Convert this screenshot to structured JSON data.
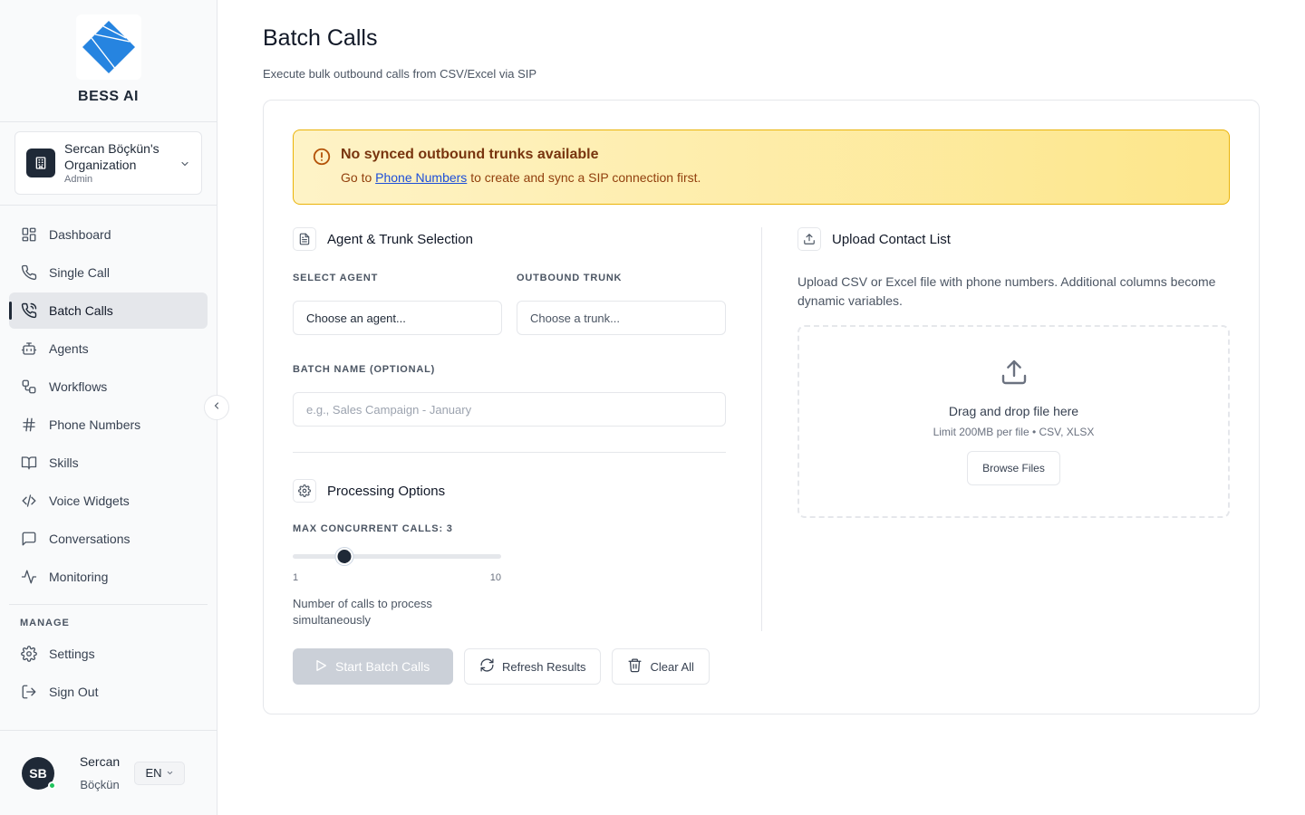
{
  "brand": {
    "name": "BESS AI",
    "logo_color": "#2563eb"
  },
  "org": {
    "name": "Sercan Böçkün's Organization",
    "role": "Admin"
  },
  "nav": {
    "items": [
      {
        "label": "Dashboard",
        "icon": "grid-icon"
      },
      {
        "label": "Single Call",
        "icon": "phone-icon"
      },
      {
        "label": "Batch Calls",
        "icon": "phone-outgoing-icon",
        "active": true
      },
      {
        "label": "Agents",
        "icon": "bot-icon"
      },
      {
        "label": "Workflows",
        "icon": "workflow-icon"
      },
      {
        "label": "Phone Numbers",
        "icon": "hash-icon"
      },
      {
        "label": "Skills",
        "icon": "book-icon"
      },
      {
        "label": "Voice Widgets",
        "icon": "code-icon"
      },
      {
        "label": "Conversations",
        "icon": "message-icon"
      },
      {
        "label": "Monitoring",
        "icon": "activity-icon"
      }
    ],
    "manage_label": "MANAGE",
    "manage_items": [
      {
        "label": "Settings",
        "icon": "gear-icon"
      },
      {
        "label": "Sign Out",
        "icon": "sign-out-icon"
      }
    ]
  },
  "user": {
    "initials": "SB",
    "first_name": "Sercan",
    "last_name": "Böçkün",
    "language": "EN"
  },
  "page": {
    "title": "Batch Calls",
    "subtitle": "Execute bulk outbound calls from CSV/Excel via SIP"
  },
  "alert": {
    "title": "No synced outbound trunks available",
    "msg_prefix": "Go to",
    "link": "Phone Numbers",
    "msg_suffix": "to create and sync a SIP connection first."
  },
  "agent_section": {
    "title": "Agent & Trunk Selection",
    "agent_label": "SELECT AGENT",
    "agent_value": "Choose an agent...",
    "trunk_label": "OUTBOUND TRUNK",
    "trunk_value": "Choose a trunk...",
    "batch_label": "BATCH NAME (OPTIONAL)",
    "batch_placeholder": "e.g., Sales Campaign - January"
  },
  "processing": {
    "title": "Processing Options",
    "concurrent_label": "MAX CONCURRENT CALLS: 3",
    "min": 1,
    "max": 10,
    "value": 3,
    "min_label": "1",
    "max_label": "10",
    "hint": "Number of calls to process simultaneously"
  },
  "actions": {
    "start": "Start Batch Calls",
    "refresh": "Refresh Results",
    "clear": "Clear All"
  },
  "upload": {
    "title": "Upload Contact List",
    "desc": "Upload CSV or Excel file with phone numbers. Additional columns become dynamic variables.",
    "drop_title": "Drag and drop file here",
    "limit": "Limit 200MB per file • CSV, XLSX",
    "browse": "Browse Files"
  },
  "colors": {
    "alert_border": "#eab308",
    "alert_text": "#78350f",
    "link": "#1d4ed8",
    "active_bg": "#e5e7eb"
  }
}
